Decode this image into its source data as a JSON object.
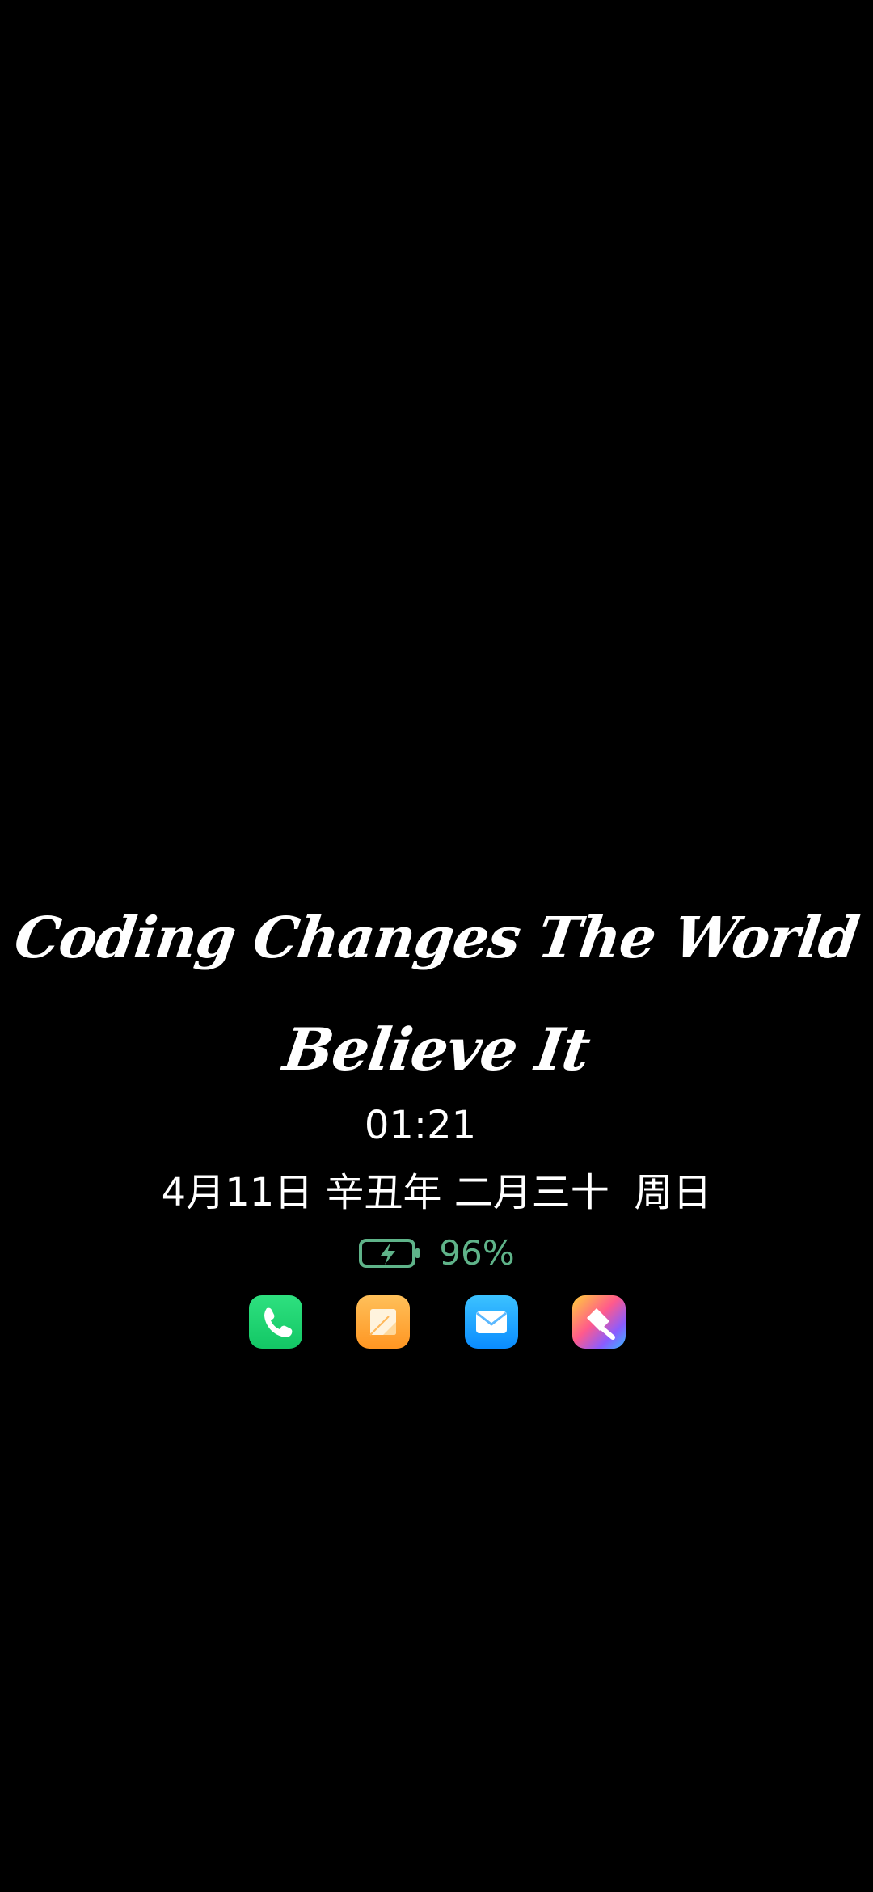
{
  "screen": {
    "type": "always-on-display"
  },
  "motto": {
    "line1": "Coding Changes The World",
    "line2": "Believe It"
  },
  "clock": {
    "time": "01:21"
  },
  "date": {
    "text": "4月11日 辛丑年 二月三十  周日"
  },
  "battery": {
    "percent_text": "96%",
    "level": 0.96,
    "charging": true,
    "color": "#5fb389",
    "icon": "battery-charging-icon"
  },
  "dock": {
    "apps": [
      {
        "name": "phone",
        "icon": "phone-icon",
        "color": "#1fd471"
      },
      {
        "name": "notes",
        "icon": "notes-icon",
        "color": "#ffa63b"
      },
      {
        "name": "mail",
        "icon": "mail-icon",
        "color": "#1aa7ff"
      },
      {
        "name": "themes",
        "icon": "theme-brush-icon",
        "color": "#ff5a8c"
      }
    ]
  }
}
